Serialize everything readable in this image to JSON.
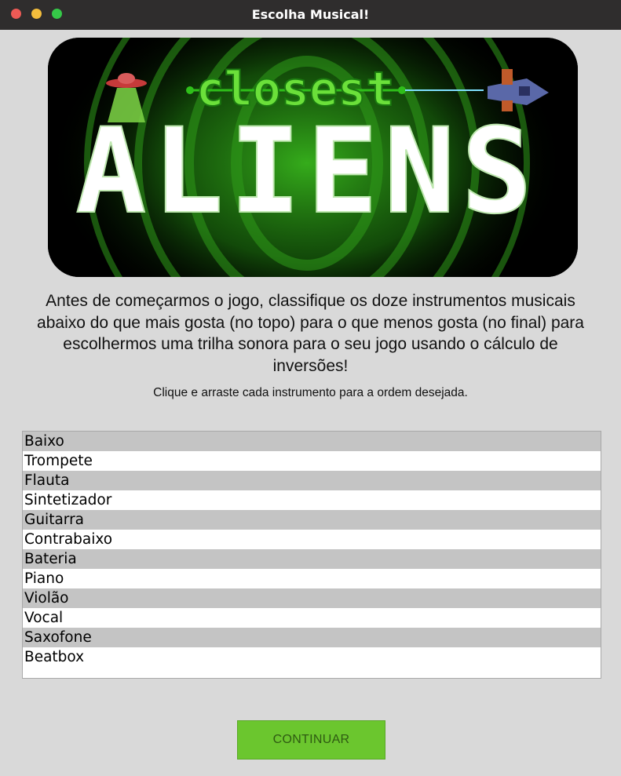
{
  "window": {
    "title": "Escolha Musical!"
  },
  "banner": {
    "logo_small": "closest",
    "logo_big": "ALIENS",
    "colors": {
      "accent": "#5fd62e",
      "background": "#000000"
    }
  },
  "intro": {
    "text": "Antes de começarmos o jogo, classifique os doze instrumentos musicais abaixo do que mais gosta (no topo) para o que menos gosta (no final) para escolhermos uma trilha sonora para o seu jogo usando o cálculo de inversões!",
    "hint": "Clique e arraste cada instrumento para a ordem desejada."
  },
  "instruments": [
    "Baixo",
    "Trompete",
    "Flauta",
    "Sintetizador",
    "Guitarra",
    "Contrabaixo",
    "Bateria",
    "Piano",
    "Violão",
    "Vocal",
    "Saxofone",
    "Beatbox"
  ],
  "continue_label": "CONTINUAR",
  "colors": {
    "button": "#6bc62e",
    "row_alt": "#c4c4c4",
    "window_bg": "#d9d9d9"
  }
}
